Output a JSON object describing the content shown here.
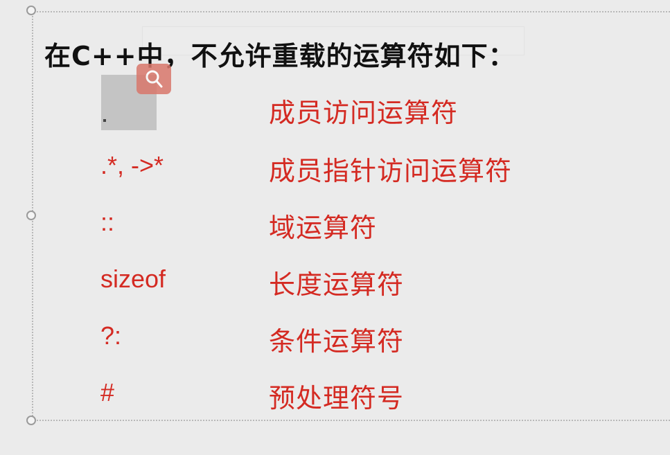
{
  "heading": "在C++中，不允许重载的运算符如下：",
  "operators": [
    {
      "symbol": ".",
      "description": "成员访问运算符"
    },
    {
      "symbol": ".*, ->*",
      "description": "成员指针访问运算符"
    },
    {
      "symbol": "::",
      "description": "域运算符"
    },
    {
      "symbol": "sizeof",
      "description": "长度运算符"
    },
    {
      "symbol": "?:",
      "description": "条件运算符"
    },
    {
      "symbol": "#",
      "description": "预处理符号"
    }
  ],
  "colors": {
    "accent_red": "#d42a22",
    "heading": "#111111",
    "badge": "#d9776b"
  },
  "icons": {
    "zoom_badge": "magnifier-icon"
  }
}
